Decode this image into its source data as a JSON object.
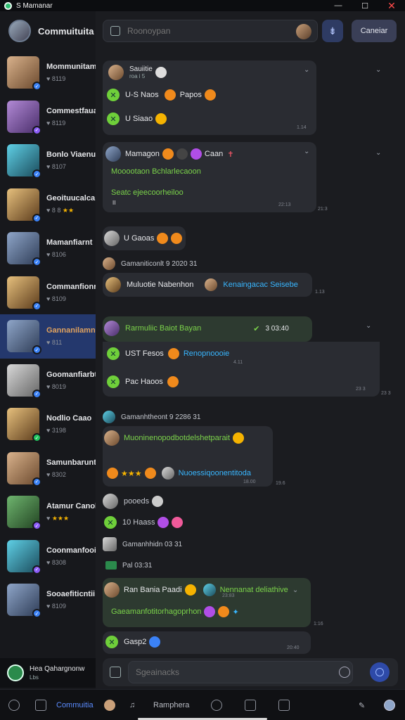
{
  "window": {
    "title": "S Mamanar",
    "minimize": "—",
    "maximize": "☐",
    "close": "✕"
  },
  "sidebar": {
    "title": "Commuituita",
    "items": [
      {
        "name": "Mommunitamn",
        "sub": "8119",
        "badge": "blue"
      },
      {
        "name": "Commestfauan",
        "sub": "8119",
        "badge": "purple"
      },
      {
        "name": "Bonlo Viaenut",
        "sub": "8107",
        "badge": "blue"
      },
      {
        "name": "Geoituucalca",
        "sub": "8 8",
        "stars": "★★",
        "badge": "blue"
      },
      {
        "name": "Mamanfiarnt",
        "sub": "8106",
        "badge": "blue"
      },
      {
        "name": "Commanfionr",
        "sub": "8109",
        "badge": "blue"
      },
      {
        "name": "Gannanilamn",
        "sub": "811",
        "badge": "blue",
        "active": true
      },
      {
        "name": "Goomanfiarbt",
        "sub": "8019",
        "badge": "blue"
      },
      {
        "name": "Nodlio Caao",
        "sub": "3198",
        "badge": "green"
      },
      {
        "name": "Samunbarunt",
        "sub": "8302",
        "badge": "blue"
      },
      {
        "name": "Atamur Canol",
        "sub": "",
        "stars": "★★★",
        "badge": "purple"
      },
      {
        "name": "Coonmanfooir",
        "sub": "8308",
        "badge": "purple"
      },
      {
        "name": "Sooaefiticntii",
        "sub": "8109",
        "badge": "blue"
      }
    ],
    "footer": {
      "name": "Hea Qahargnonw",
      "sub": "Lbs"
    }
  },
  "search": {
    "placeholder": "Roonoypan"
  },
  "buttons": {
    "filter": "⇟",
    "cancel": "Caneiar"
  },
  "messages": {
    "m1": {
      "user": "Sauiitie",
      "user_sub": "roa i 5",
      "l1": "U-S Naos",
      "l1b": "Papos",
      "l2": "U Siaao",
      "ts": "1.14"
    },
    "m2": {
      "user": "Mamagon",
      "user_b": "Caan",
      "l1": "Mooootaon Bchlarlecaoon",
      "l2": "Seatc ejeecoorheiloo",
      "l3": "II",
      "ts": "22:13",
      "ts_out": "21:3"
    },
    "m3": {
      "user": "U Gaoas"
    },
    "sys1": "Gamaniticonlt 9 2020 31",
    "m4": {
      "user": "Muluotie Nabenhon",
      "link": "Kenaingacac Seisebe",
      "ts": "1.13"
    },
    "m5": {
      "user": "Rarmuliic Baiot Bayan",
      "user_b": "3 03:40",
      "l1": "UST Fesos",
      "l1b": "Renopnoooie",
      "l2": "Pac Haoos",
      "ts1": "4.11",
      "ts2": "23 3",
      "ts_out": "23 3"
    },
    "sys2": "Gamanhtheont 9 2286 31",
    "m6": {
      "l1": "Muoninenopodbotdelshetparait",
      "l2b": "Nuoessiqoonentitoda",
      "ts": "18.00",
      "ts_out": "19.6"
    },
    "m7": {
      "user": "pooeds"
    },
    "m8": {
      "user": "10 Haass"
    },
    "sys3": "Gamanhhidn 03 31",
    "sys4": "Pal 03:31",
    "m9": {
      "user": "Ran Bania Paadi",
      "user_b": "Nennanat deliathive",
      "user_b2": "23:83",
      "l1": "Gaeamanfotitorhagoprhon",
      "ts": "18.13",
      "ts_out": "1:16"
    },
    "m10": {
      "user": "Gasp2",
      "ts": "20:40"
    }
  },
  "composer": {
    "placeholder": "Sgeainacks"
  },
  "bottomnav": {
    "active_label": "Commuitia",
    "label2": "Ramphera"
  },
  "colors": {
    "accent": "#5b8cff",
    "green_text": "#7bd34a",
    "link_blue": "#38b6ff",
    "active_item": "#24386d"
  }
}
